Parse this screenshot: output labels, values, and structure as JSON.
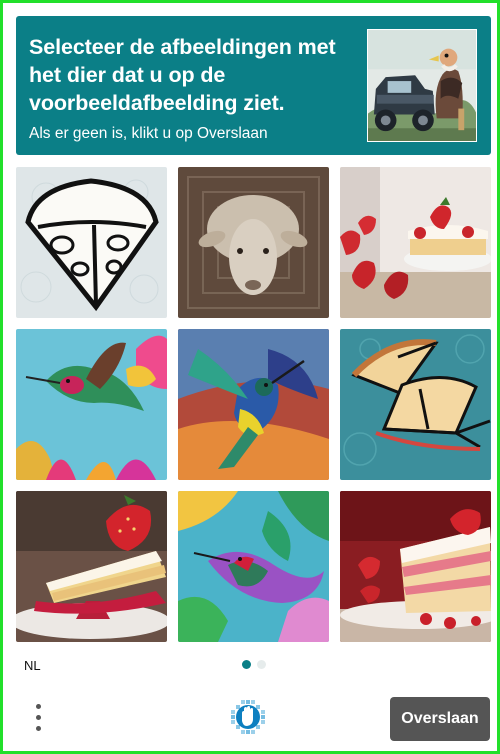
{
  "header": {
    "prompt": "Selecteer de afbeeldingen met het dier dat u op de voorbeeldafbeelding ziet.",
    "sub": "Als er geen is, klikt u op Overslaan",
    "background": "#0b7f87",
    "sample_image": "monster-truck-with-vulture"
  },
  "grid": {
    "tiles": [
      {
        "subject": "pizza-slice-drawing"
      },
      {
        "subject": "sheep-face"
      },
      {
        "subject": "strawberry-cake"
      },
      {
        "subject": "hummingbird-painting"
      },
      {
        "subject": "hummingbird-painting"
      },
      {
        "subject": "pizza-slices-drawing"
      },
      {
        "subject": "strawberry-cake-slice"
      },
      {
        "subject": "hummingbird-painting"
      },
      {
        "subject": "strawberry-cake-slice"
      }
    ]
  },
  "footer": {
    "language": "NL",
    "pagination": {
      "current": 1,
      "total": 2
    },
    "skip_label": "Overslaan",
    "menu_icon": "vertical-ellipsis-icon",
    "logo_icon": "hand-logo-icon"
  }
}
